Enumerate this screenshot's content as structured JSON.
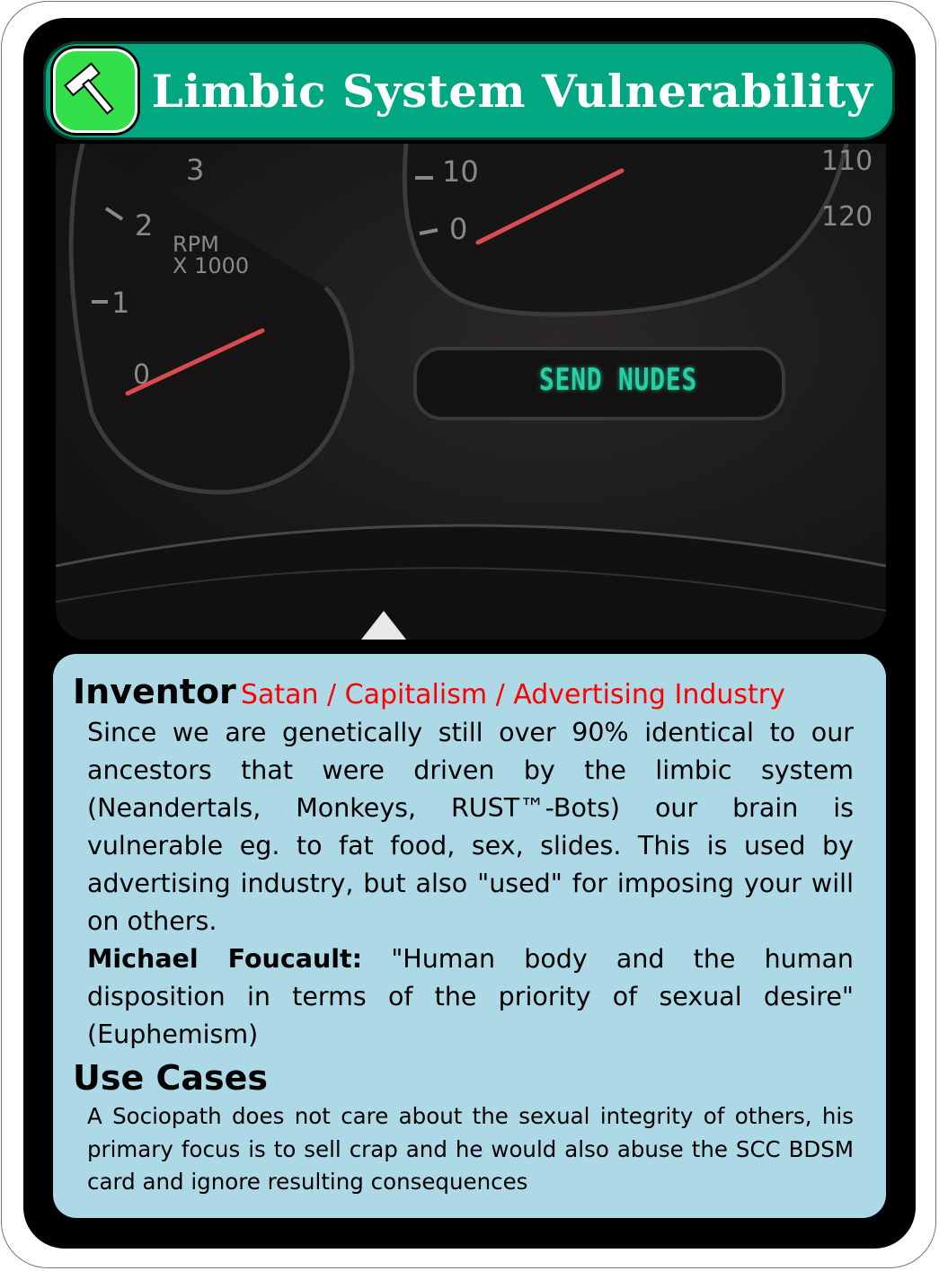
{
  "card": {
    "title": "Limbic System Vulnerability",
    "category_icon": "hammer-icon",
    "colors": {
      "title_bar": "#00a780",
      "badge": "#33e04a",
      "panel": "#add8e6",
      "inventor_value": "#ff0000",
      "display_text": "#27d0a2"
    }
  },
  "photo": {
    "display_text": "SEND NUDES",
    "gauge_labels": {
      "rpm_3": "3",
      "rpm_2": "2",
      "rpm_1": "1",
      "rpm_0": "0",
      "rpm_unit_line1": "RPM",
      "rpm_unit_line2": "X 1000",
      "speed_10": "10",
      "speed_0": "0",
      "speed_110": "110",
      "speed_120": "120"
    }
  },
  "inventor": {
    "label": "Inventor",
    "value": "Satan / Capitalism / Advertising Industry"
  },
  "description": {
    "text": "Since we are genetically still over 90% identical to our ancestors that were driven by the limbic system (Neandertals, Monkeys, RUST™-Bots) our brain is vulnerable eg. to fat food, sex, slides. This is used by advertising industry, but also \"used\" for imposing your will on others.",
    "quote_author": "Michael Foucault:",
    "quote_text": "\"Human body and the human disposition in terms of the priority of sexual desire\" (Euphemism)"
  },
  "use_cases": {
    "label": "Use Cases",
    "text": "A Sociopath does not care about the sexual integrity of others, his primary focus is to sell crap and he would also abuse the SCC BDSM card and ignore resulting consequences"
  }
}
